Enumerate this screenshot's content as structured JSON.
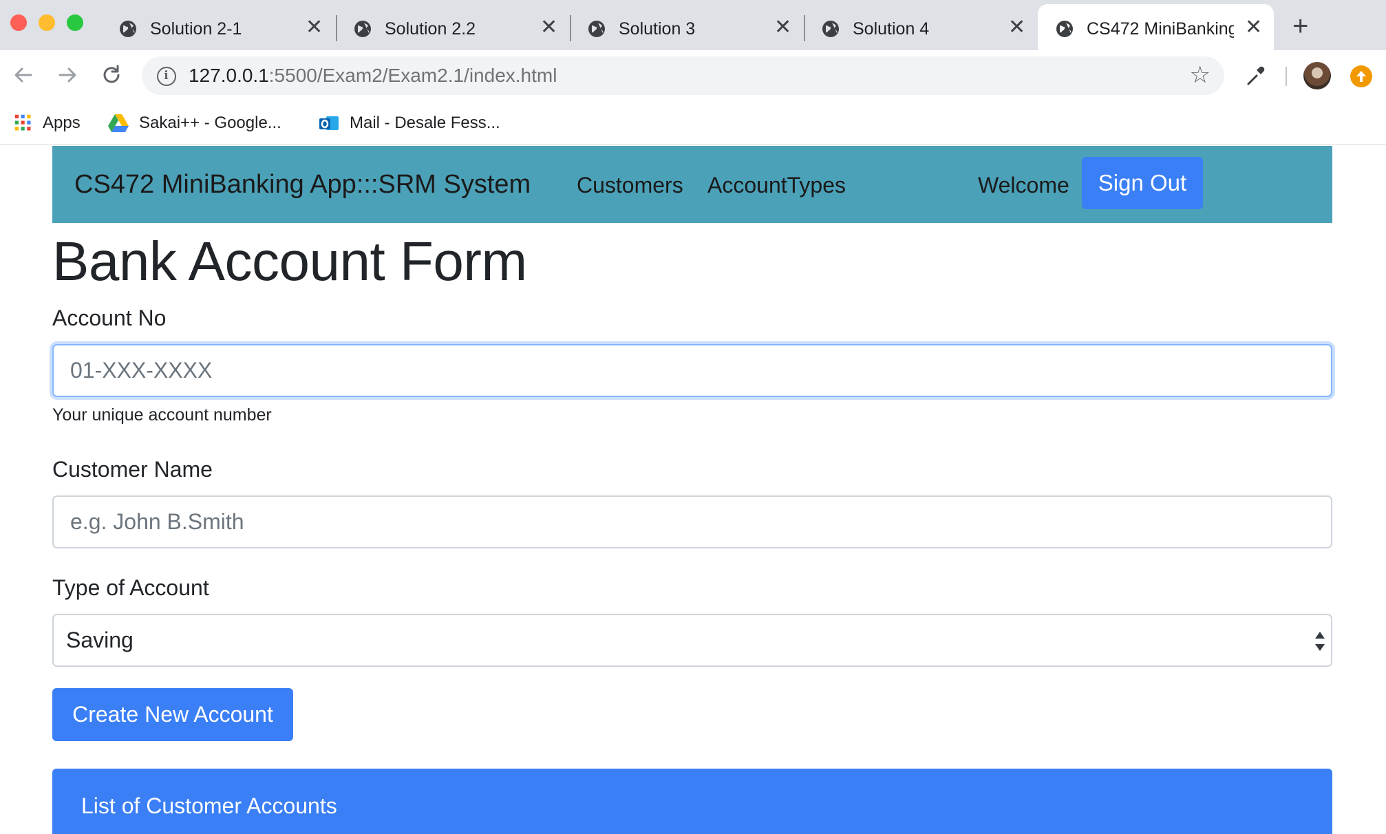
{
  "browser": {
    "tabs": [
      {
        "title": "Solution 2-1",
        "icon": "globe-icon"
      },
      {
        "title": "Solution 2.2",
        "icon": "globe-icon"
      },
      {
        "title": "Solution 3",
        "icon": "globe-icon"
      },
      {
        "title": "Solution 4",
        "icon": "globe-icon"
      },
      {
        "title": "CS472 MiniBanking",
        "icon": "globe-icon",
        "active": true
      }
    ],
    "url_host": "127.0.0.1",
    "url_path": ":5500/Exam2/Exam2.1/index.html",
    "bookmarks": [
      {
        "label": "Apps",
        "icon": "apps-grid-icon"
      },
      {
        "label": "Sakai++ - Google...",
        "icon": "google-drive-icon"
      },
      {
        "label": "Mail - Desale Fess...",
        "icon": "outlook-icon"
      }
    ]
  },
  "navbar": {
    "brand": "CS472 MiniBanking App:::SRM System",
    "links": [
      "Customers",
      "AccountTypes"
    ],
    "welcome": "Welcome",
    "signout_label": "Sign Out",
    "color": "#4ba1b8"
  },
  "form": {
    "title": "Bank Account Form",
    "account_no": {
      "label": "Account No",
      "placeholder": "01-XXX-XXXX",
      "value": "",
      "help": "Your unique account number"
    },
    "customer_name": {
      "label": "Customer Name",
      "placeholder": "e.g. John B.Smith",
      "value": ""
    },
    "account_type": {
      "label": "Type of Account",
      "selected": "Saving"
    },
    "submit_label": "Create New Account"
  },
  "accounts_panel": {
    "title": "List of Customer Accounts"
  },
  "colors": {
    "primary": "#3a7ff6",
    "navbar": "#4ba1b8",
    "text": "#212529"
  }
}
